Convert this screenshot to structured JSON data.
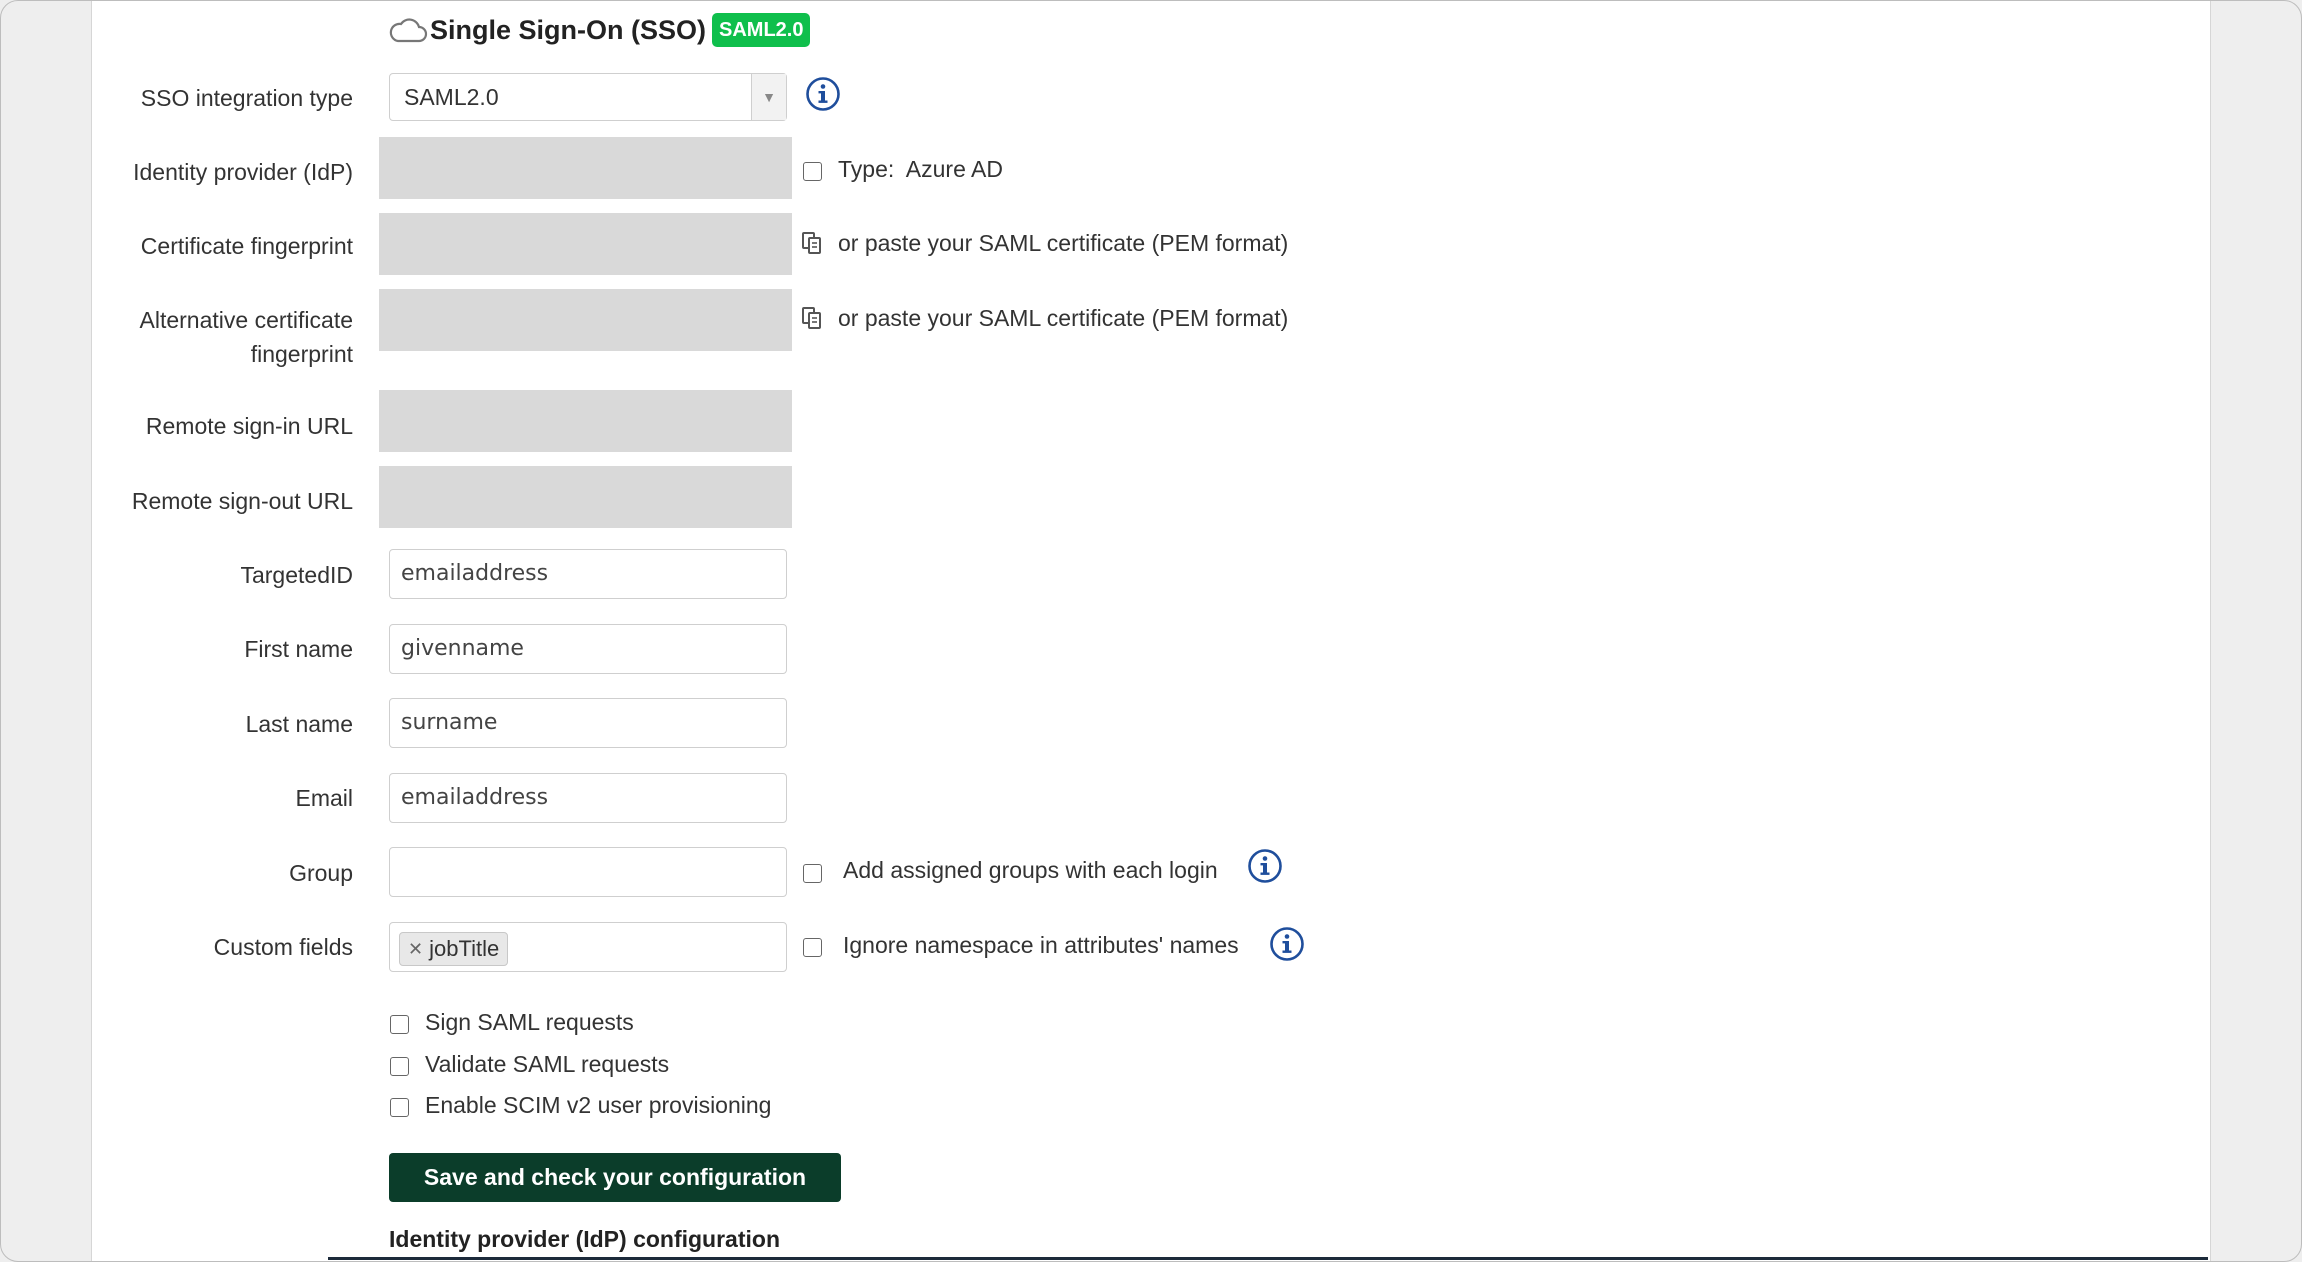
{
  "header": {
    "title": "Single Sign-On (SSO)",
    "badge": "SAML2.0",
    "icon": "cloud-icon"
  },
  "colors": {
    "badge_bg": "#0fbf4c",
    "button_bg": "#0b3d2a",
    "info_icon": "#1f4e9c",
    "disabled_field": "#d9d9d9"
  },
  "form": {
    "sso_type": {
      "label": "SSO integration type",
      "value": "SAML2.0"
    },
    "idp": {
      "label": "Identity provider (IdP)",
      "type_prefix": "Type:",
      "type_value": "Azure AD"
    },
    "cert": {
      "label": "Certificate fingerprint",
      "paste_text": "or paste your SAML certificate (PEM format)"
    },
    "alt_cert": {
      "label_line1": "Alternative certificate",
      "label_line2": "fingerprint",
      "paste_text": "or paste your SAML certificate (PEM format)"
    },
    "signin_url": {
      "label": "Remote sign-in URL"
    },
    "signout_url": {
      "label": "Remote sign-out URL"
    },
    "targeted_id": {
      "label": "TargetedID",
      "value": "emailaddress"
    },
    "first_name": {
      "label": "First name",
      "value": "givenname"
    },
    "last_name": {
      "label": "Last name",
      "value": "surname"
    },
    "email": {
      "label": "Email",
      "value": "emailaddress"
    },
    "group": {
      "label": "Group",
      "value": "",
      "checkbox_label": "Add assigned groups with each login"
    },
    "custom_fields": {
      "label": "Custom fields",
      "tags": [
        "jobTitle"
      ],
      "checkbox_label": "Ignore namespace in attributes' names"
    },
    "options": [
      {
        "label": "Sign SAML requests",
        "checked": false
      },
      {
        "label": "Validate SAML requests",
        "checked": false
      },
      {
        "label": "Enable SCIM v2 user provisioning",
        "checked": false
      }
    ],
    "save_label": "Save and check your configuration",
    "section_heading": "Identity provider (IdP) configuration"
  }
}
